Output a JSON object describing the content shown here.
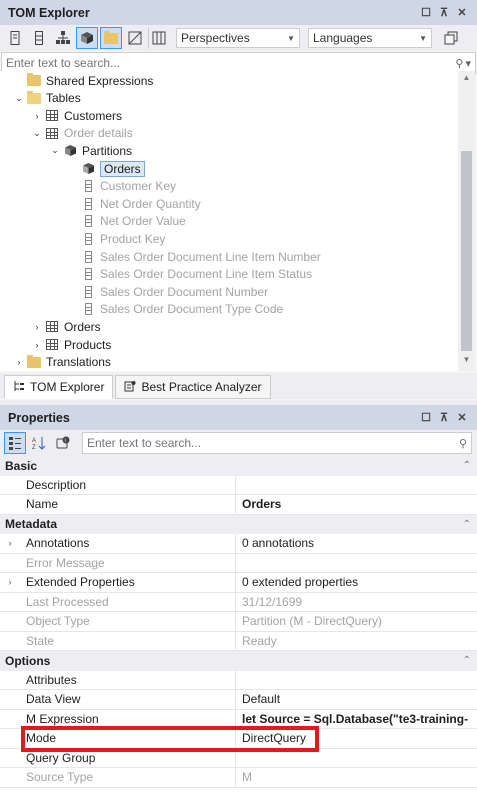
{
  "tom_panel": {
    "title": "TOM Explorer",
    "title_buttons": [
      "□",
      "⊼",
      "✕"
    ],
    "perspectives_label": "Perspectives",
    "languages_label": "Languages",
    "search_placeholder": "Enter text to search..."
  },
  "tree": [
    {
      "label": "Shared Expressions",
      "indent": 1,
      "icon": "folder-icon",
      "expander": "",
      "dim": false,
      "selected": false
    },
    {
      "label": "Tables",
      "indent": 1,
      "icon": "folder-open-icon",
      "expander": "⌄",
      "dim": false,
      "selected": false
    },
    {
      "label": "Customers",
      "indent": 2,
      "icon": "table-icon",
      "expander": "›",
      "dim": false,
      "selected": false
    },
    {
      "label": "Order details",
      "indent": 2,
      "icon": "table-icon",
      "expander": "⌄",
      "dim": true,
      "selected": false
    },
    {
      "label": "Partitions",
      "indent": 3,
      "icon": "partitions-icon",
      "expander": "⌄",
      "dim": false,
      "selected": false
    },
    {
      "label": "Orders",
      "indent": 4,
      "icon": "partition-icon",
      "expander": "",
      "dim": false,
      "selected": true
    },
    {
      "label": "Customer Key",
      "indent": 4,
      "icon": "column-icon",
      "expander": "",
      "dim": true,
      "selected": false
    },
    {
      "label": "Net Order Quantity",
      "indent": 4,
      "icon": "column-icon",
      "expander": "",
      "dim": true,
      "selected": false
    },
    {
      "label": "Net Order Value",
      "indent": 4,
      "icon": "column-icon",
      "expander": "",
      "dim": true,
      "selected": false
    },
    {
      "label": "Product Key",
      "indent": 4,
      "icon": "column-icon",
      "expander": "",
      "dim": true,
      "selected": false
    },
    {
      "label": "Sales Order Document Line Item Number",
      "indent": 4,
      "icon": "column-icon",
      "expander": "",
      "dim": true,
      "selected": false
    },
    {
      "label": "Sales Order Document Line Item Status",
      "indent": 4,
      "icon": "column-icon",
      "expander": "",
      "dim": true,
      "selected": false
    },
    {
      "label": "Sales Order Document Number",
      "indent": 4,
      "icon": "column-icon",
      "expander": "",
      "dim": true,
      "selected": false
    },
    {
      "label": "Sales Order Document Type Code",
      "indent": 4,
      "icon": "column-icon",
      "expander": "",
      "dim": true,
      "selected": false
    },
    {
      "label": "Orders",
      "indent": 2,
      "icon": "table-icon",
      "expander": "›",
      "dim": false,
      "selected": false
    },
    {
      "label": "Products",
      "indent": 2,
      "icon": "table-icon",
      "expander": "›",
      "dim": false,
      "selected": false
    },
    {
      "label": "Translations",
      "indent": 1,
      "icon": "folder-icon",
      "expander": "›",
      "dim": false,
      "selected": false
    }
  ],
  "tabs": [
    {
      "label": "TOM Explorer",
      "icon": "tree-icon",
      "active": true
    },
    {
      "label": "Best Practice Analyzer",
      "icon": "analyzer-icon",
      "active": false
    }
  ],
  "props_panel": {
    "title": "Properties",
    "search_placeholder": "Enter text to search..."
  },
  "properties": {
    "basic_label": "Basic",
    "metadata_label": "Metadata",
    "options_label": "Options",
    "basic": [
      {
        "name": "Description",
        "value": "",
        "dim": false,
        "bold": false,
        "exp": ""
      },
      {
        "name": "Name",
        "value": "Orders",
        "dim": false,
        "bold": true,
        "exp": ""
      }
    ],
    "metadata": [
      {
        "name": "Annotations",
        "value": "0 annotations",
        "dim": false,
        "bold": false,
        "exp": "›"
      },
      {
        "name": "Error Message",
        "value": "",
        "dim": true,
        "bold": false,
        "exp": ""
      },
      {
        "name": "Extended Properties",
        "value": "0 extended properties",
        "dim": false,
        "bold": false,
        "exp": "›"
      },
      {
        "name": "Last Processed",
        "value": "31/12/1699",
        "dim": true,
        "bold": false,
        "exp": ""
      },
      {
        "name": "Object Type",
        "value": "Partition (M - DirectQuery)",
        "dim": true,
        "bold": false,
        "exp": ""
      },
      {
        "name": "State",
        "value": "Ready",
        "dim": true,
        "bold": false,
        "exp": ""
      }
    ],
    "options": [
      {
        "name": "Attributes",
        "value": "",
        "dim": false,
        "bold": false,
        "exp": ""
      },
      {
        "name": "Data View",
        "value": "Default",
        "dim": false,
        "bold": false,
        "exp": ""
      },
      {
        "name": "M Expression",
        "value": "let    Source = Sql.Database(\"te3-training-",
        "dim": false,
        "bold": true,
        "exp": ""
      },
      {
        "name": "Mode",
        "value": "DirectQuery",
        "dim": false,
        "bold": false,
        "exp": ""
      },
      {
        "name": "Query Group",
        "value": "",
        "dim": false,
        "bold": false,
        "exp": ""
      },
      {
        "name": "Source Type",
        "value": "M",
        "dim": true,
        "bold": false,
        "exp": ""
      }
    ]
  },
  "colors": {
    "highlight": "#e21a1a",
    "selection": "#dce8f7",
    "titlebar": "#cfd6e5"
  }
}
